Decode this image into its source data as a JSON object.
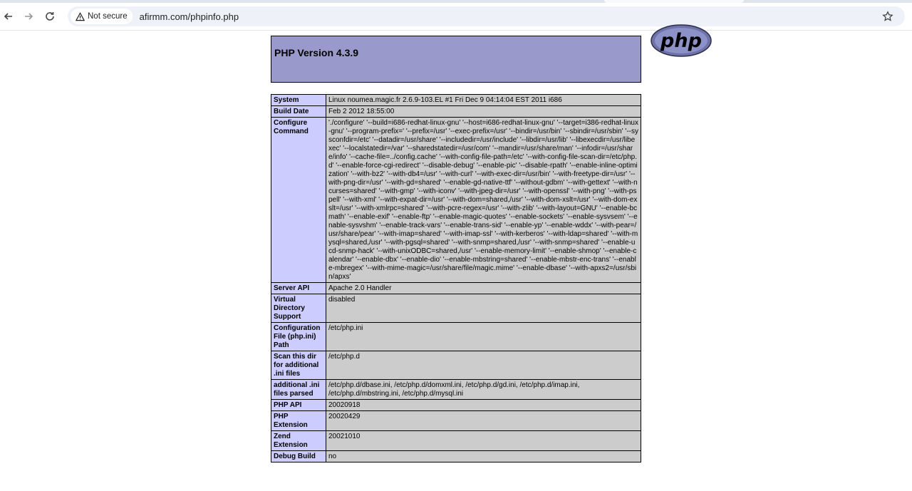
{
  "browser": {
    "security_label": "Not secure",
    "url": "afirmm.com/phpinfo.php"
  },
  "header": {
    "title": "PHP Version 4.3.9",
    "logo_text": "php"
  },
  "rows": [
    {
      "key": "System",
      "value": "Linux noumea.magic.fr 2.6.9-103.EL #1 Fri Dec 9 04:14:04 EST 2011 i686"
    },
    {
      "key": "Build Date",
      "value": "Feb 2 2012 18:55:00"
    },
    {
      "key": "Configure Command",
      "value": "'./configure' '--build=i686-redhat-linux-gnu' '--host=i686-redhat-linux-gnu' '--target=i386-redhat-linux-gnu' '--program-prefix=' '--prefix=/usr' '--exec-prefix=/usr' '--bindir=/usr/bin' '--sbindir=/usr/sbin' '--sysconfdir=/etc' '--datadir=/usr/share' '--includedir=/usr/include' '--libdir=/usr/lib' '--libexecdir=/usr/libexec' '--localstatedir=/var' '--sharedstatedir=/usr/com' '--mandir=/usr/share/man' '--infodir=/usr/share/info' '--cache-file=../config.cache' '--with-config-file-path=/etc' '--with-config-file-scan-dir=/etc/php.d' '--enable-force-cgi-redirect' '--disable-debug' '--enable-pic' '--disable-rpath' '--enable-inline-optimization' '--with-bz2' '--with-db4=/usr' '--with-curl' '--with-exec-dir=/usr/bin' '--with-freetype-dir=/usr' '--with-png-dir=/usr' '--with-gd=shared' '--enable-gd-native-ttf' '--without-gdbm' '--with-gettext' '--with-ncurses=shared' '--with-gmp' '--with-iconv' '--with-jpeg-dir=/usr' '--with-openssl' '--with-png' '--with-pspell' '--with-xml' '--with-expat-dir=/usr' '--with-dom=shared,/usr' '--with-dom-xslt=/usr' '--with-dom-exslt=/usr' '--with-xmlrpc=shared' '--with-pcre-regex=/usr' '--with-zlib' '--with-layout=GNU' '--enable-bcmath' '--enable-exif' '--enable-ftp' '--enable-magic-quotes' '--enable-sockets' '--enable-sysvsem' '--enable-sysvshm' '--enable-track-vars' '--enable-trans-sid' '--enable-yp' '--enable-wddx' '--with-pear=/usr/share/pear' '--with-imap=shared' '--with-imap-ssl' '--with-kerberos' '--with-ldap=shared' '--with-mysql=shared,/usr' '--with-pgsql=shared' '--with-snmp=shared,/usr' '--with-snmp=shared' '--enable-ucd-snmp-hack' '--with-unixODBC=shared,/usr' '--enable-memory-limit' '--enable-shmop' '--enable-calendar' '--enable-dbx' '--enable-dio' '--enable-mbstring=shared' '--enable-mbstr-enc-trans' '--enable-mbregex' '--with-mime-magic=/usr/share/file/magic.mime' '--enable-dbase' '--with-apxs2=/usr/sbin/apxs'"
    },
    {
      "key": "Server API",
      "value": "Apache 2.0 Handler"
    },
    {
      "key": "Virtual Directory Support",
      "value": "disabled"
    },
    {
      "key": "Configuration File (php.ini) Path",
      "value": "/etc/php.ini"
    },
    {
      "key": "Scan this dir for additional .ini files",
      "value": "/etc/php.d"
    },
    {
      "key": "additional .ini files parsed",
      "value": "/etc/php.d/dbase.ini, /etc/php.d/domxml.ini, /etc/php.d/gd.ini, /etc/php.d/imap.ini, /etc/php.d/mbstring.ini, /etc/php.d/mysql.ini"
    },
    {
      "key": "PHP API",
      "value": "20020918"
    },
    {
      "key": "PHP Extension",
      "value": "20020429"
    },
    {
      "key": "Zend Extension",
      "value": "20021010"
    },
    {
      "key": "Debug Build",
      "value": "no"
    }
  ],
  "colors": {
    "header_bg": "#9999cc",
    "key_bg": "#ccccff",
    "value_bg": "#cccccc"
  }
}
